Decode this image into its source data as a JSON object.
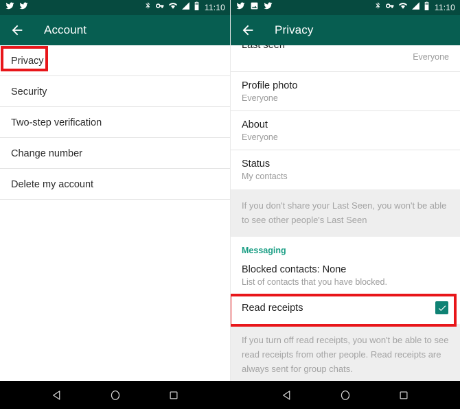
{
  "left_panel": {
    "statusbar": {
      "notification_icons": [
        "twitter-icon",
        "twitter-icon"
      ],
      "system_icons": [
        "bluetooth-icon",
        "vpn-key-icon",
        "wifi-icon",
        "signal-icon",
        "battery-icon"
      ],
      "time": "11:10"
    },
    "appbar": {
      "back_icon": "arrow-back-icon",
      "title": "Account"
    },
    "items": [
      {
        "label": "Privacy"
      },
      {
        "label": "Security"
      },
      {
        "label": "Two-step verification"
      },
      {
        "label": "Change number"
      },
      {
        "label": "Delete my account"
      }
    ]
  },
  "right_panel": {
    "statusbar": {
      "notification_icons": [
        "twitter-icon",
        "image-icon",
        "twitter-icon"
      ],
      "system_icons": [
        "bluetooth-icon",
        "vpn-key-icon",
        "wifi-icon",
        "signal-icon",
        "battery-icon"
      ],
      "time": "11:10"
    },
    "appbar": {
      "back_icon": "arrow-back-icon",
      "title": "Privacy"
    },
    "privacy_rows": [
      {
        "title": "Last seen",
        "value": "Everyone"
      },
      {
        "title": "Profile photo",
        "value": "Everyone"
      },
      {
        "title": "About",
        "value": "Everyone"
      },
      {
        "title": "Status",
        "value": "My contacts"
      }
    ],
    "last_seen_note": "If you don't share your Last Seen, you won't be able to see other people's Last Seen",
    "messaging": {
      "header": "Messaging",
      "blocked_contacts": {
        "title": "Blocked contacts: None",
        "subtitle": "List of contacts that you have blocked."
      },
      "read_receipts": {
        "label": "Read receipts",
        "checked": true,
        "checkbox_color": "#0f8274"
      },
      "read_receipts_note": "If you turn off read receipts, you won't be able to see read receipts from other people. Read receipts are always sent for group chats."
    }
  },
  "annotations": {
    "highlight_color": "#e8161a",
    "boxes": [
      "privacy-menu-item",
      "read-receipts-row"
    ]
  },
  "navbar": {
    "buttons": [
      "back-nav-button",
      "home-nav-button",
      "recents-nav-button"
    ]
  },
  "theme": {
    "statusbar_color": "#064a3f",
    "appbar_color": "#075e51",
    "accent_color": "#1a9e84"
  }
}
